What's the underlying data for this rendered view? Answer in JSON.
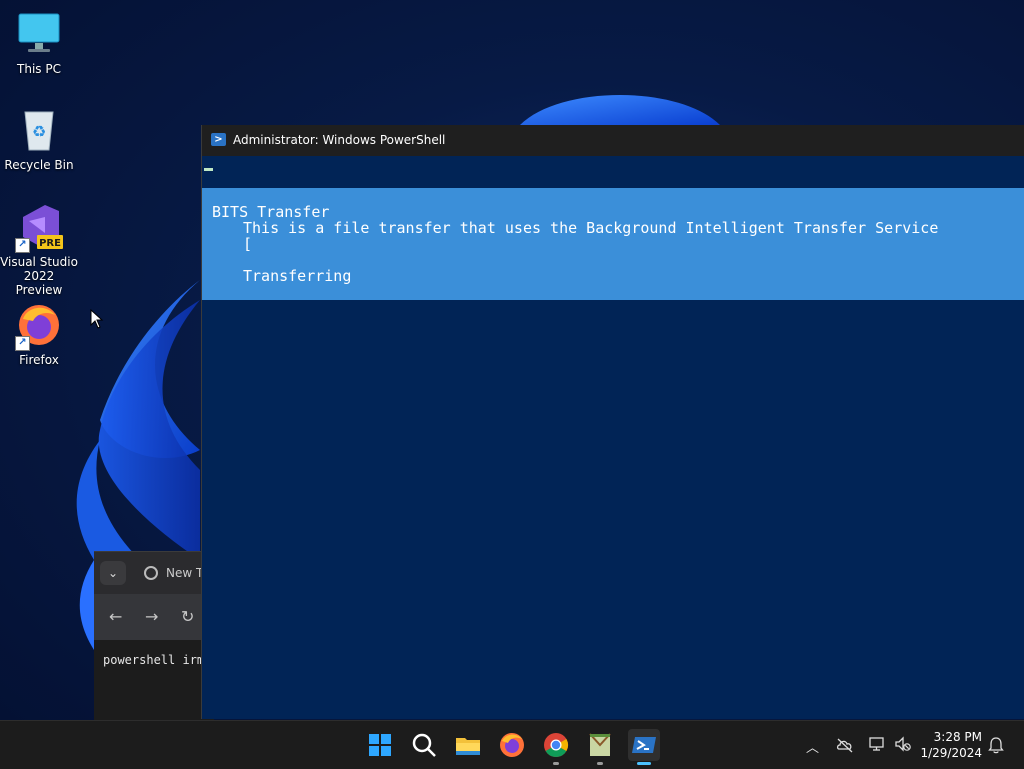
{
  "desktop": {
    "icons": [
      {
        "label": "This PC"
      },
      {
        "label": "Recycle Bin"
      },
      {
        "label": "Visual Studio 2022 Preview",
        "badge": "PRE"
      },
      {
        "label": "Firefox"
      }
    ]
  },
  "browser": {
    "tab_title": "New Ta",
    "content_text": "powershell irm"
  },
  "powershell": {
    "title": "Administrator: Windows PowerShell",
    "progress": {
      "activity": "BITS Transfer",
      "description": "This is a file transfer that uses the Background Intelligent Transfer Service",
      "bar": "[",
      "status": "Transferring"
    }
  },
  "taskbar": {
    "apps": [
      "start-icon",
      "search-icon",
      "file-explorer-icon",
      "firefox-icon",
      "chrome-icon",
      "notepad-icon",
      "powershell-icon"
    ],
    "time": "3:28 PM",
    "date": "1/29/2024"
  },
  "colors": {
    "ps_background": "#012456",
    "progress_background": "#3b8fd9",
    "taskbar": "#1c1c1c",
    "accent": "#4cc2ff"
  }
}
